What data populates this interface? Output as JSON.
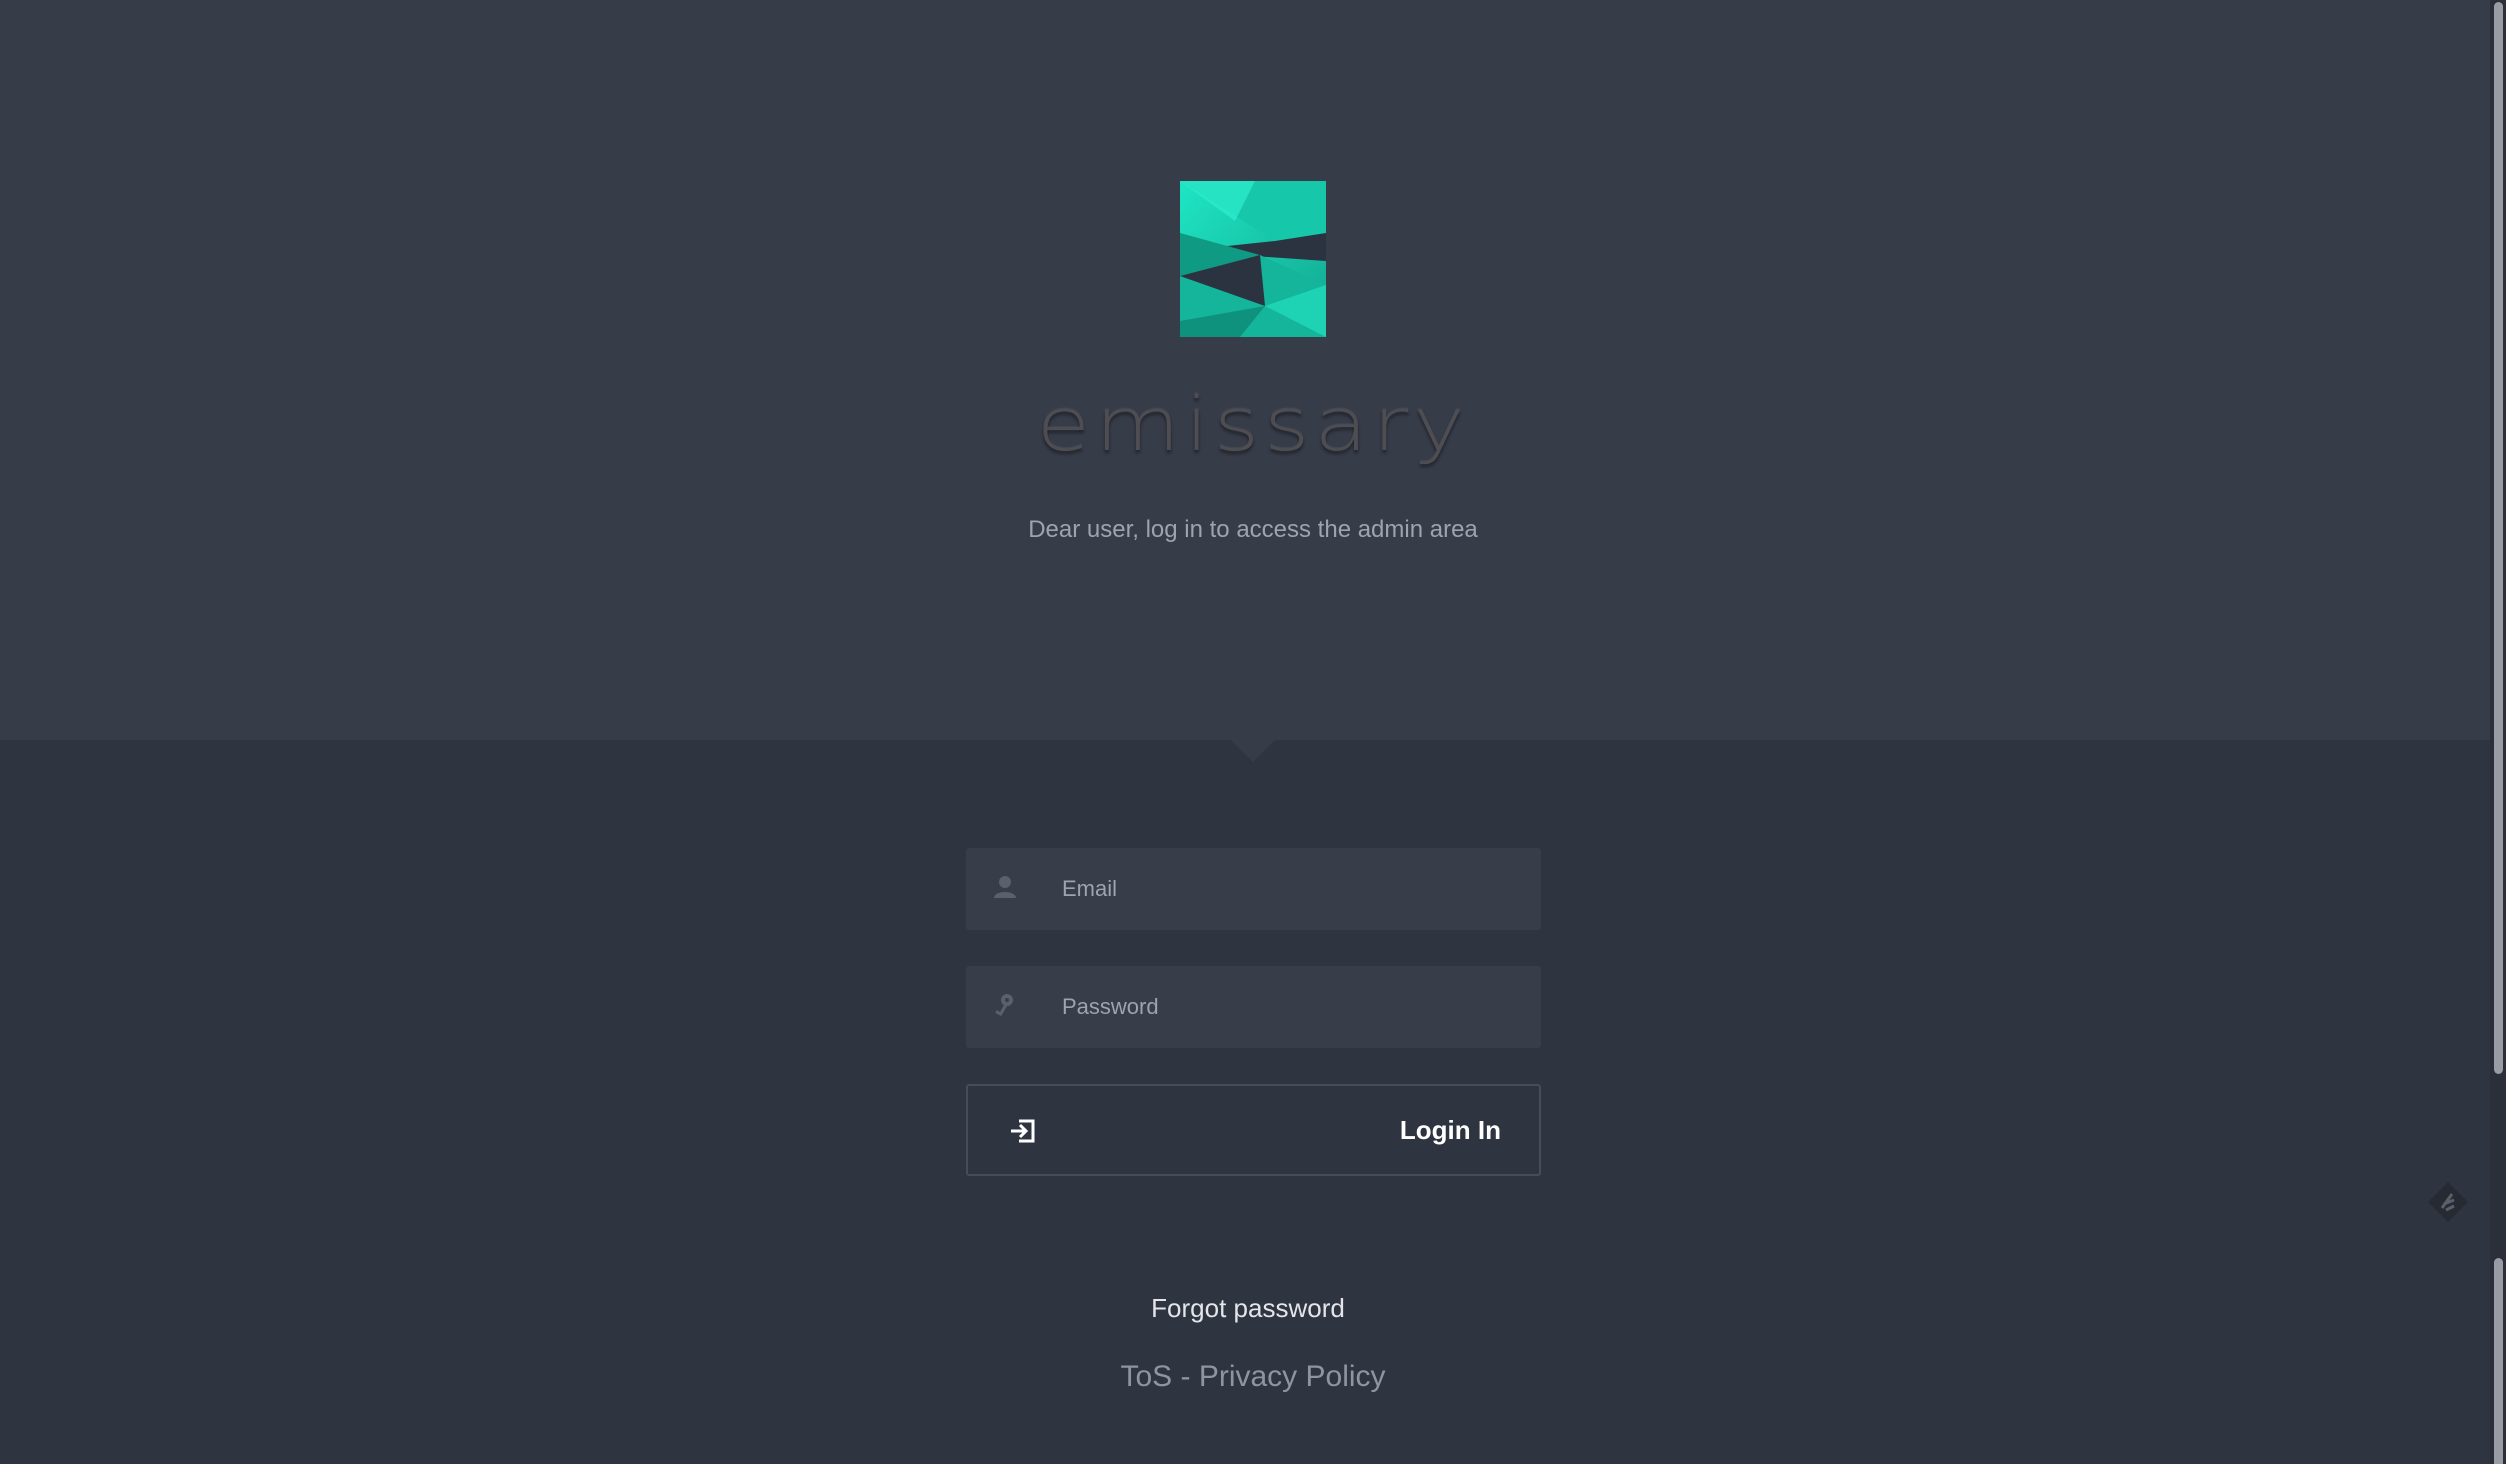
{
  "brand": {
    "name": "emissary",
    "logo_icon": "emissary-sigma-logo",
    "accent_color": "#1ed3b4"
  },
  "hero": {
    "subtitle": "Dear user, log in to access the admin area"
  },
  "form": {
    "email": {
      "icon": "user-icon",
      "placeholder": "Email",
      "value": ""
    },
    "password": {
      "icon": "key-icon",
      "placeholder": "Password",
      "value": ""
    },
    "submit": {
      "icon": "login-icon",
      "label": "Login In"
    }
  },
  "links": {
    "forgot_password": "Forgot password",
    "tos": "ToS",
    "separator": " - ",
    "privacy_policy": "Privacy Policy"
  },
  "colors": {
    "hero_bg": "#373c49",
    "page_bg": "#2f3441",
    "field_bg": "#383d4a"
  }
}
